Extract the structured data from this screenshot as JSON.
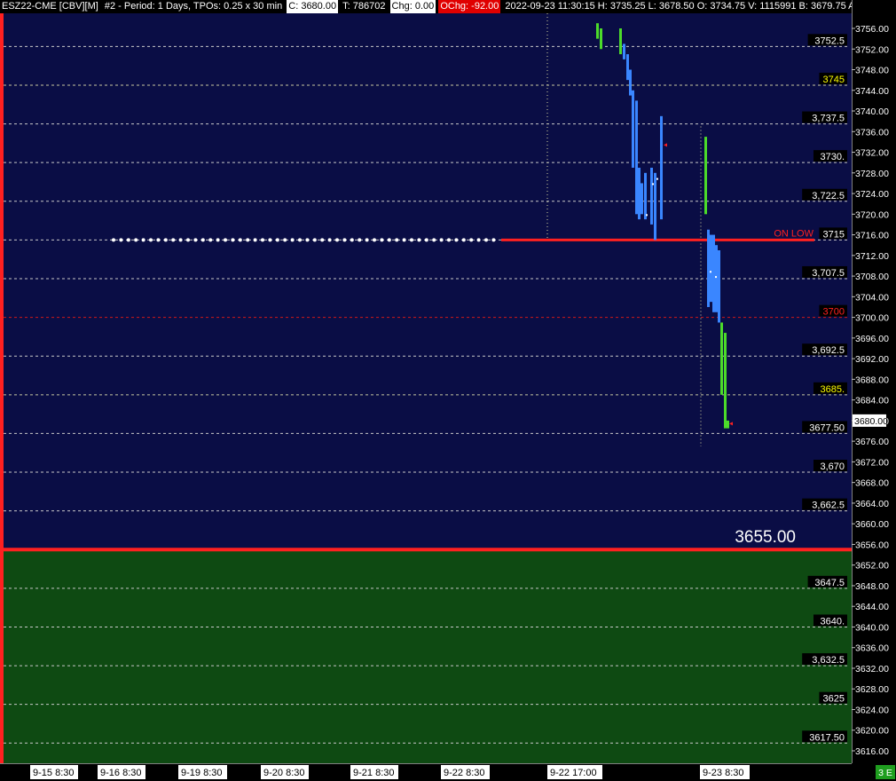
{
  "header": {
    "symbol": "ESZ22-CME [CBV][M]",
    "study": "#2 - Period: 1 Days, TPOs: 0.25 x 30 min",
    "close": "C: 3680.00",
    "ticks": "T: 786702",
    "change": "Chg: 0.00",
    "ochange": "OChg: -92.00",
    "bar_info": "2022-09-23 11:30:15 H: 3735.25 L: 3678.50 O: 3734.75 V: 1115991 B: 3679.75 A"
  },
  "colors": {
    "upper_bg": "#0a0d45",
    "lower_bg": "#0e4a12",
    "profile_blue": "#3a86ff",
    "profile_green": "#4cdb2a",
    "level_red": "#ff2020",
    "label_yellow": "#ffff00"
  },
  "price_axis": {
    "min": 3614,
    "max": 3758,
    "ticks": [
      "3756.00",
      "3752.00",
      "3748.00",
      "3744.00",
      "3740.00",
      "3736.00",
      "3732.00",
      "3728.00",
      "3724.00",
      "3720.00",
      "3716.00",
      "3712.00",
      "3708.00",
      "3704.00",
      "3700.00",
      "3696.00",
      "3692.00",
      "3688.00",
      "3684.00",
      "3680.00",
      "3676.00",
      "3672.00",
      "3668.00",
      "3664.00",
      "3660.00",
      "3656.00",
      "3652.00",
      "3648.00",
      "3644.00",
      "3640.00",
      "3636.00",
      "3632.00",
      "3628.00",
      "3624.00",
      "3620.00",
      "3616.00"
    ],
    "current_price_label": "3680.00",
    "current_price": 3680
  },
  "levels": [
    {
      "price": 3752.5,
      "label": "3752.5",
      "style": "white"
    },
    {
      "price": 3745,
      "label": "3745",
      "style": "yellow"
    },
    {
      "price": 3737.5,
      "label": "3,737.5",
      "style": "white"
    },
    {
      "price": 3730,
      "label": "3730.",
      "style": "white"
    },
    {
      "price": 3722.5,
      "label": "3,722.5",
      "style": "white"
    },
    {
      "price": 3715,
      "label": "3715",
      "style": "white"
    },
    {
      "price": 3707.5,
      "label": "3,707.5",
      "style": "white"
    },
    {
      "price": 3700,
      "label": "3700",
      "style": "red"
    },
    {
      "price": 3692.5,
      "label": "3,692.5",
      "style": "white"
    },
    {
      "price": 3685,
      "label": "3685.",
      "style": "yellow"
    },
    {
      "price": 3677.5,
      "label": "3677.50",
      "style": "white"
    },
    {
      "price": 3670,
      "label": "3,670",
      "style": "white"
    },
    {
      "price": 3662.5,
      "label": "3,662.5",
      "style": "white"
    },
    {
      "price": 3647.5,
      "label": "3647.5",
      "style": "white"
    },
    {
      "price": 3640,
      "label": "3640.",
      "style": "white"
    },
    {
      "price": 3632.5,
      "label": "3,632.5",
      "style": "white"
    },
    {
      "price": 3625,
      "label": "3625",
      "style": "white"
    },
    {
      "price": 3617.5,
      "label": "3617.50",
      "style": "white"
    }
  ],
  "key_level": {
    "price": 3655,
    "label": "3655.00"
  },
  "on_low": {
    "price": 3715,
    "label": "ON LOW"
  },
  "time_axis": {
    "labels": [
      "9-15  8:30",
      "9-16  8:30",
      "9-19  8:30",
      "9-20  8:30",
      "9-21  8:30",
      "9-22  8:30",
      "9-22  17:00",
      "9-23  8:30"
    ],
    "corner_badge": "3 E"
  },
  "chart_data": {
    "type": "bar",
    "title": "ESZ22-CME [CBV][M]  #2 - Period: 1 Days, TPOs: 0.25 x 30 min",
    "profile_segments": [
      {
        "session": "9-22",
        "color": "green",
        "low": 3754,
        "high": 3757
      },
      {
        "session": "9-22",
        "color": "green",
        "low": 3752,
        "high": 3756
      },
      {
        "session": "9-22",
        "color": "green",
        "low": 3751,
        "high": 3756
      },
      {
        "session": "9-22",
        "color": "blue",
        "low": 3750,
        "high": 3753
      },
      {
        "session": "9-22",
        "color": "blue",
        "low": 3746,
        "high": 3751
      },
      {
        "session": "9-22",
        "color": "blue",
        "low": 3743,
        "high": 3748
      },
      {
        "session": "9-22",
        "color": "blue",
        "low": 3729,
        "high": 3744
      },
      {
        "session": "9-22",
        "color": "blue",
        "low": 3720,
        "high": 3742
      },
      {
        "session": "9-22",
        "color": "blue",
        "low": 3719,
        "high": 3729
      },
      {
        "session": "9-22",
        "color": "blue",
        "low": 3720,
        "high": 3726
      },
      {
        "session": "9-22",
        "color": "blue",
        "low": 3719,
        "high": 3728
      },
      {
        "session": "9-22",
        "color": "blue",
        "low": 3718,
        "high": 3729
      },
      {
        "session": "9-22",
        "color": "blue",
        "low": 3715,
        "high": 3728
      },
      {
        "session": "9-22",
        "color": "blue",
        "low": 3719,
        "high": 3739
      },
      {
        "session": "9-23",
        "color": "green",
        "low": 3720,
        "high": 3735
      },
      {
        "session": "9-23",
        "color": "blue",
        "low": 3702,
        "high": 3717
      },
      {
        "session": "9-23",
        "color": "blue",
        "low": 3703,
        "high": 3716
      },
      {
        "session": "9-23",
        "color": "blue",
        "low": 3701,
        "high": 3716
      },
      {
        "session": "9-23",
        "color": "blue",
        "low": 3701,
        "high": 3714
      },
      {
        "session": "9-23",
        "color": "blue",
        "low": 3699,
        "high": 3713
      },
      {
        "session": "9-23",
        "color": "green",
        "low": 3685,
        "high": 3699
      },
      {
        "session": "9-23",
        "color": "green",
        "low": 3678.5,
        "high": 3697
      },
      {
        "session": "9-23",
        "color": "green",
        "low": 3678.5,
        "high": 3680
      }
    ]
  }
}
